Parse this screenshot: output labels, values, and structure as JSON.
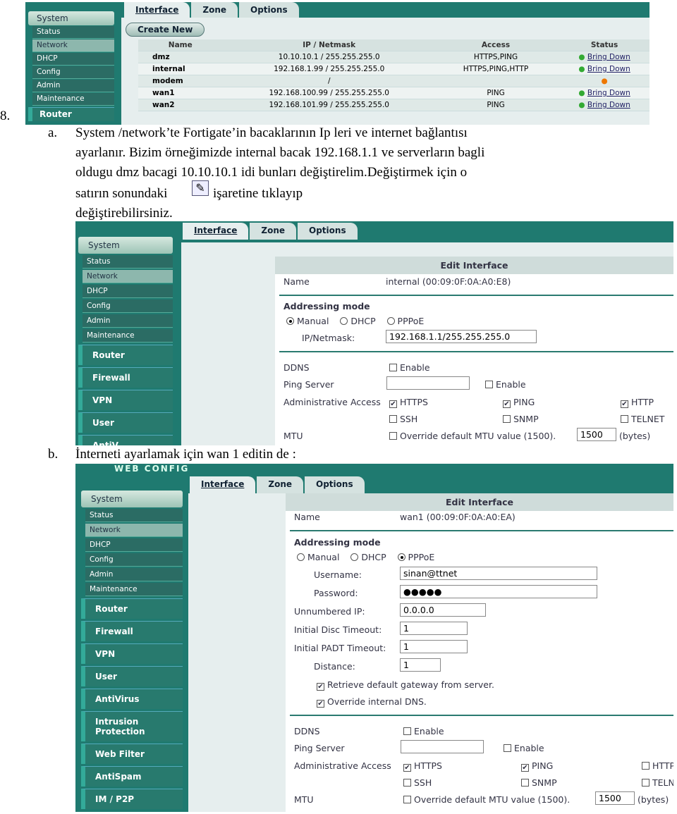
{
  "doc": {
    "item_number": "8.",
    "a_marker": "a.",
    "a_lines": [
      "System /network’te Fortigate’in bacaklarının Ip leri ve internet bağlantısı",
      "ayarlanır. Bizim örneğimizde internal bacak 192.168.1.1 ve serverların bagli",
      "oldugu dmz bacagi 10.10.10.1 idi bunları değiştirelim.Değiştirmek için o",
      "satırın sonundaki",
      "işaretine tıklayıp",
      "değiştirebilirsiniz."
    ],
    "b_marker": "b.",
    "b_line": "İnterneti ayarlamak için wan 1 editin de :"
  },
  "tabs": [
    "Interface",
    "Zone",
    "Options"
  ],
  "sidebar": {
    "system": "System",
    "subs": [
      "Status",
      "Network",
      "DHCP",
      "Config",
      "Admin",
      "Maintenance"
    ],
    "groups1": [
      "Router"
    ],
    "groups2": [
      "Router",
      "Firewall",
      "VPN",
      "User",
      "AntiV"
    ],
    "groups3": [
      "Router",
      "Firewall",
      "VPN",
      "User",
      "AntiVirus",
      "Intrusion Protection",
      "Web Filter",
      "AntiSpam",
      "IM / P2P"
    ]
  },
  "shot1": {
    "create_new": "Create New",
    "columns": [
      "Name",
      "IP / Netmask",
      "Access",
      "Status"
    ],
    "rows": [
      {
        "name": "dmz",
        "ip": "10.10.10.1 / 255.255.255.0",
        "access": "HTTPS,PING",
        "status": "Bring Down"
      },
      {
        "name": "internal",
        "ip": "192.168.1.99 / 255.255.255.0",
        "access": "HTTPS,PING,HTTP",
        "status": "Bring Down"
      },
      {
        "name": "modem",
        "ip": "/",
        "access": "",
        "status": ""
      },
      {
        "name": "wan1",
        "ip": "192.168.100.99 / 255.255.255.0",
        "access": "PING",
        "status": "Bring Down"
      },
      {
        "name": "wan2",
        "ip": "192.168.101.99 / 255.255.255.0",
        "access": "PING",
        "status": "Bring Down"
      }
    ]
  },
  "shot2": {
    "title": "Edit Interface",
    "name_label": "Name",
    "name_value": "internal (00:09:0F:0A:A0:E8)",
    "addr_mode": "Addressing mode",
    "modes": [
      "Manual",
      "DHCP",
      "PPPoE"
    ],
    "selected_mode": "Manual",
    "ip_label": "IP/Netmask:",
    "ip_value": "192.168.1.1/255.255.255.0",
    "ddns": "DDNS",
    "enable": "Enable",
    "ping_server": "Ping Server",
    "admin_access": "Administrative Access",
    "access": [
      {
        "label": "HTTPS",
        "checked": true
      },
      {
        "label": "PING",
        "checked": true
      },
      {
        "label": "HTTP",
        "checked": true
      },
      {
        "label": "SSH",
        "checked": false
      },
      {
        "label": "SNMP",
        "checked": false
      },
      {
        "label": "TELNET",
        "checked": false
      }
    ],
    "mtu": "MTU",
    "mtu_override": "Override default MTU value (1500).",
    "mtu_value": "1500",
    "bytes": "(bytes)"
  },
  "shot3": {
    "header": "WEB CONFIG",
    "title": "Edit Interface",
    "name_label": "Name",
    "name_value": "wan1 (00:09:0F:0A:A0:EA)",
    "addr_mode": "Addressing mode",
    "modes": [
      "Manual",
      "DHCP",
      "PPPoE"
    ],
    "selected_mode": "PPPoE",
    "username_label": "Username:",
    "username": "sinan@ttnet",
    "password_label": "Password:",
    "password": "●●●●●",
    "unnumbered_label": "Unnumbered IP:",
    "unnumbered": "0.0.0.0",
    "disc_label": "Initial Disc Timeout:",
    "disc": "1",
    "padt_label": "Initial PADT Timeout:",
    "padt": "1",
    "distance_label": "Distance:",
    "distance": "1",
    "retrieve": "Retrieve default gateway from server.",
    "override_dns": "Override internal DNS.",
    "ddns": "DDNS",
    "enable": "Enable",
    "ping_server": "Ping Server",
    "admin_access": "Administrative Access",
    "access": [
      {
        "label": "HTTPS",
        "checked": true
      },
      {
        "label": "PING",
        "checked": true
      },
      {
        "label": "HTTP",
        "checked": false
      },
      {
        "label": "SSH",
        "checked": false
      },
      {
        "label": "SNMP",
        "checked": false
      },
      {
        "label": "TELNET",
        "checked": false
      }
    ],
    "mtu": "MTU",
    "mtu_override": "Override default MTU value (1500).",
    "mtu_value": "1500",
    "bytes": "(bytes)"
  }
}
